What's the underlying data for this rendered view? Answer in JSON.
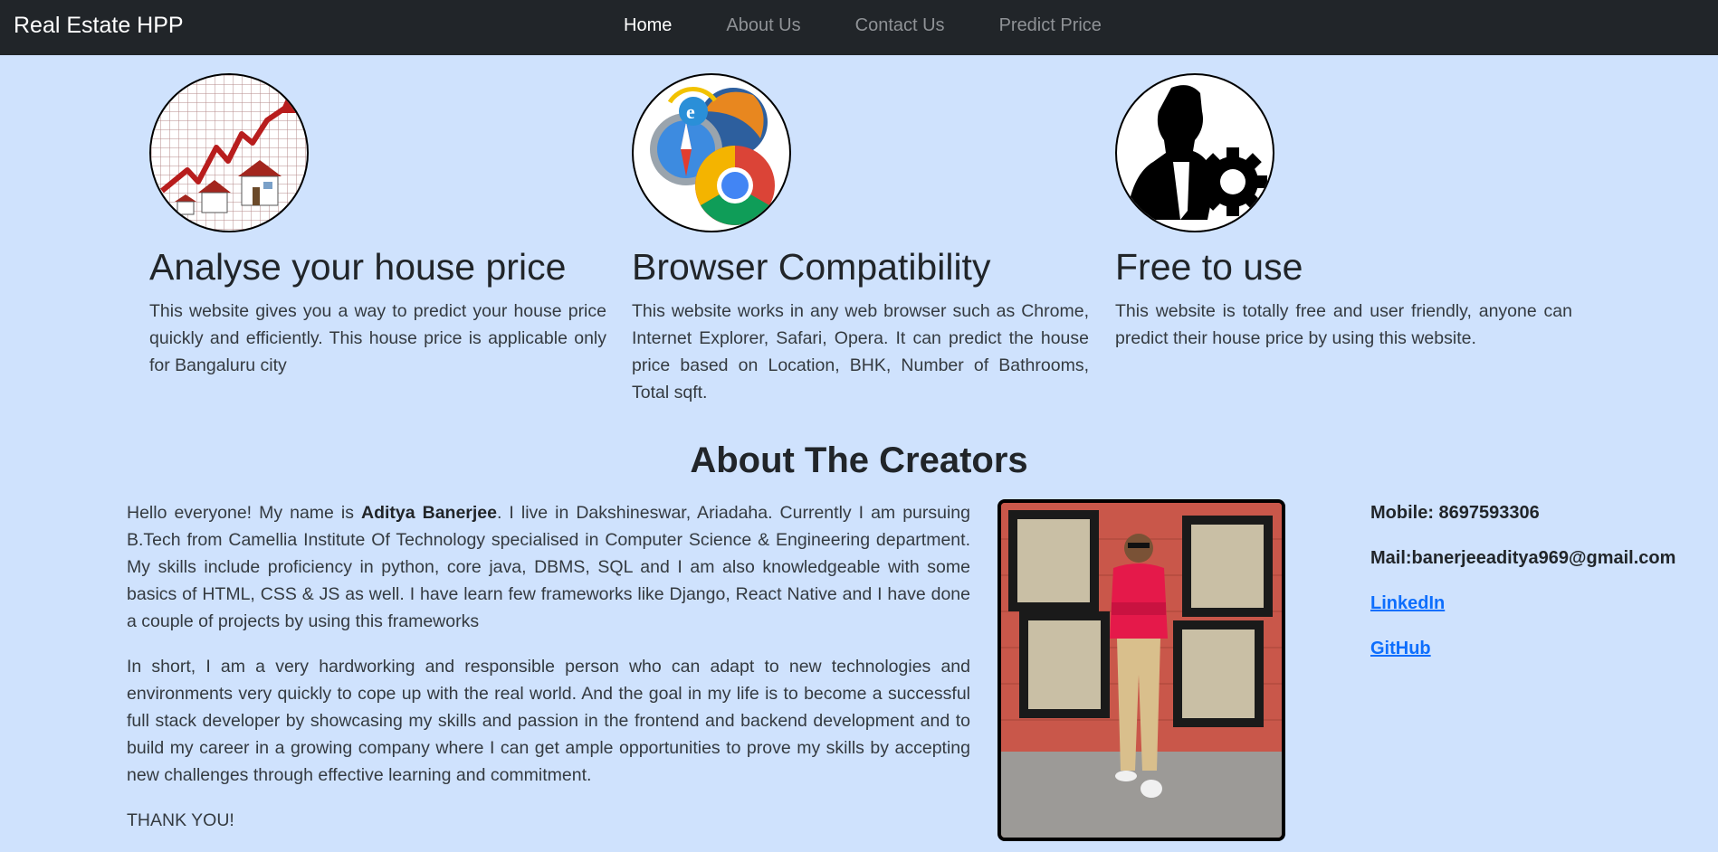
{
  "nav": {
    "brand": "Real Estate HPP",
    "links": [
      {
        "label": "Home",
        "active": true
      },
      {
        "label": "About Us",
        "active": false
      },
      {
        "label": "Contact Us",
        "active": false
      },
      {
        "label": "Predict Price",
        "active": false
      }
    ]
  },
  "features": [
    {
      "icon": "house-price-chart-icon",
      "title": "Analyse your house price",
      "text": "This website gives you a way to predict your house price quickly and efficiently. This house price is applicable only for Bangaluru city"
    },
    {
      "icon": "browsers-icon",
      "title": "Browser Compatibility",
      "text": "This website works in any web browser such as Chrome, Internet Explorer, Safari, Opera. It can predict the house price based on Location, BHK, Number of Bathrooms, Total sqft."
    },
    {
      "icon": "person-gear-icon",
      "title": "Free to use",
      "text": "This website is totally free and user friendly, anyone can predict their house price by using this website."
    }
  ],
  "about": {
    "title": "About The Creators",
    "p1_before": "Hello everyone! My name is ",
    "p1_name": "Aditya Banerjee",
    "p1_after": ". I live in Dakshineswar, Ariadaha. Currently I am pursuing B.Tech from Camellia Institute Of Technology specialised in Computer Science & Engineering department. My skills include proficiency in python, core java, DBMS, SQL and I am also knowledgeable with some basics of HTML, CSS & JS as well. I have learn few frameworks like Django, React Native and I have done a couple of projects by using this frameworks",
    "p2": "In short, I am a very hardworking and responsible person who can adapt to new technologies and environments very quickly to cope up with the real world. And the goal in my life is to become a successful full stack developer by showcasing my skills and passion in the frontend and backend development and to build my career in a growing company where I can get ample opportunities to prove my skills by accepting new challenges through effective learning and commitment.",
    "p3": "THANK YOU!"
  },
  "contact": {
    "mobile": "Mobile: 8697593306",
    "mail": "Mail:banerjeeaditya969@gmail.com",
    "linkedin": "LinkedIn",
    "github": "GitHub"
  },
  "colors": {
    "navbar": "#212529",
    "background": "#cfe2fd",
    "link": "#0d6efd"
  }
}
